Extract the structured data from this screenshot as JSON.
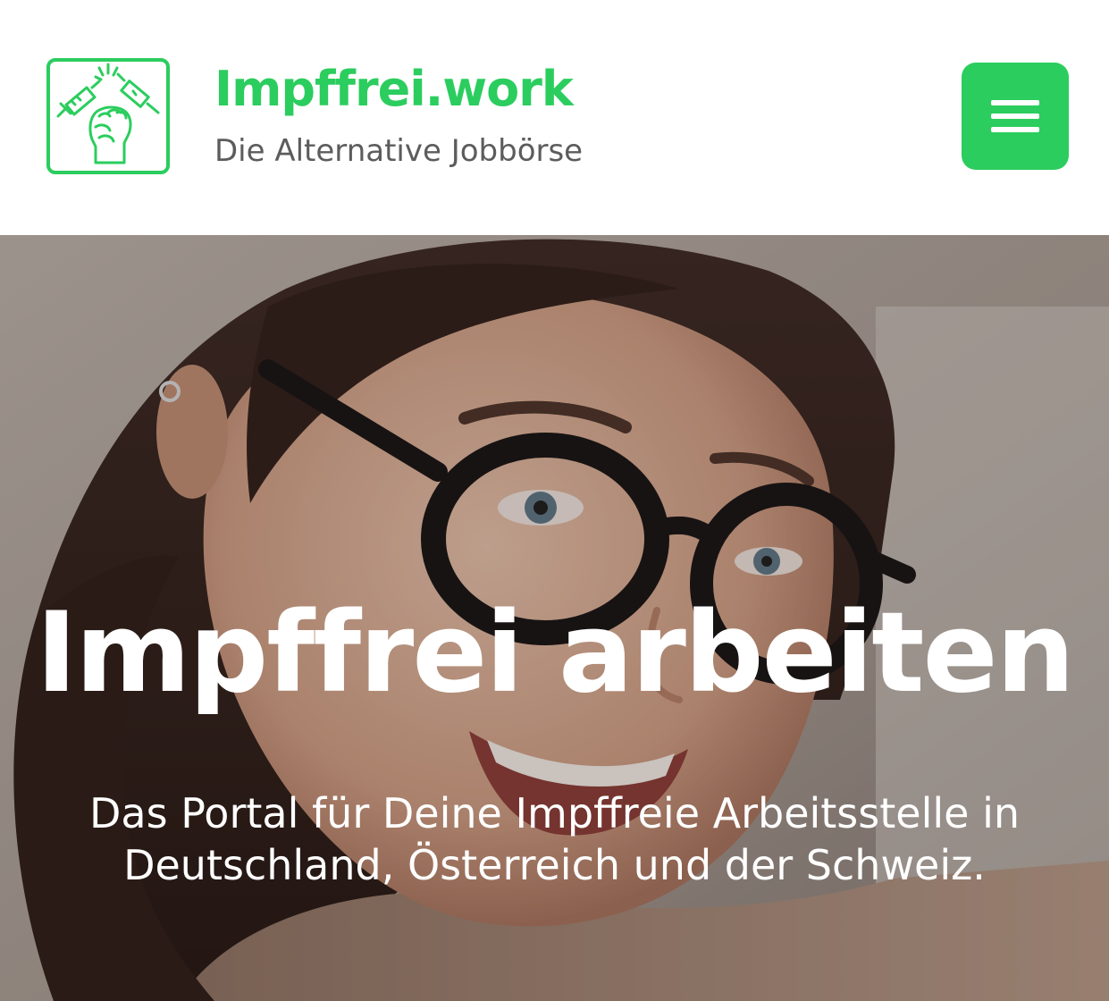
{
  "header": {
    "logo_icon": "syringe-broken-by-fist-icon",
    "title": "Impffrei.work",
    "tagline": "Die Alternative Jobbörse",
    "menu_icon": "hamburger-menu-icon"
  },
  "hero": {
    "image": "smiling-woman-with-glasses-photo",
    "title": "Impffrei arbeiten",
    "subtitle_line1": "Das Portal für Deine Impffreie Arbeitsstelle in",
    "subtitle_line2": "Deutschland, Österreich und der Schweiz."
  },
  "colors": {
    "brand_green": "#2bcd5e",
    "tagline_gray": "#5c5c5c",
    "hero_text": "#ffffff"
  }
}
